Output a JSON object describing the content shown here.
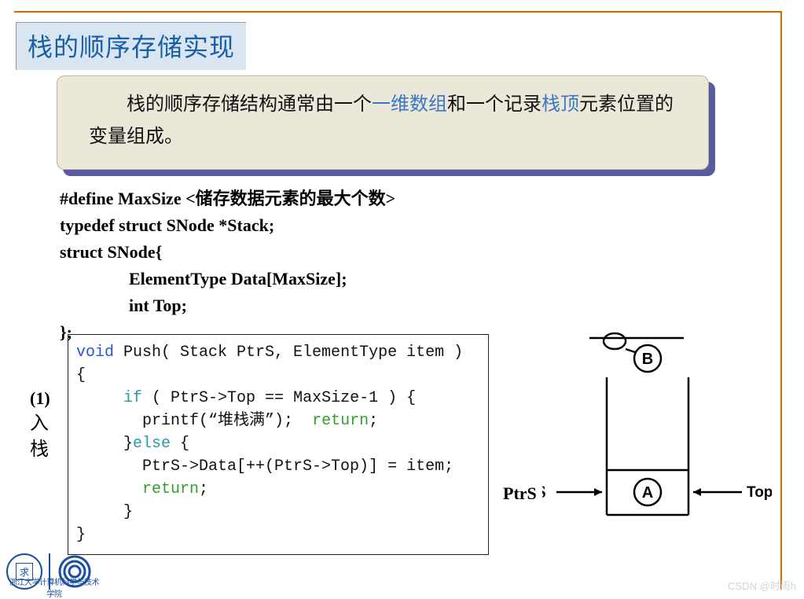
{
  "title": "栈的顺序存储实现",
  "intro": {
    "pre": "栈的顺序存储结构通常由一个",
    "hl1": "一维数组",
    "mid1": "和一个记录",
    "hl2": "栈顶",
    "post": "元素位置的变量组成。"
  },
  "codeDef": {
    "l1a": "#define MaxSize  <",
    "l1b": "储存数据元素的最大个数",
    "l1c": ">",
    "l2": "typedef  struct SNode *Stack;",
    "l3": "struct SNode{",
    "l4": "ElementType Data[MaxSize];",
    "l5": "int Top;",
    "l6": "};"
  },
  "pushLabel": {
    "num": "(1)",
    "zh1": "入",
    "zh2": "栈"
  },
  "pushCode": {
    "l1a": "void",
    "l1b": " Push( Stack PtrS, ElementType item )",
    "l2": "{",
    "l3a": "     ",
    "l3b": "if",
    "l3c": " ( PtrS->Top == MaxSize-1 ) {",
    "l4a": "       printf(",
    "l4b": "“堆栈满”",
    "l4c": ");  ",
    "l4d": "return",
    "l4e": ";",
    "l5a": "     }",
    "l5b": "else",
    "l5c": " {",
    "l6": "       PtrS->Data[++(PtrS->Top)] = item;",
    "l7a": "       ",
    "l7b": "return",
    "l7c": ";",
    "l8": "     }",
    "l9": "}"
  },
  "diagram": {
    "nodeTop": "B",
    "nodeBottom": "A",
    "leftLabel": "PtrS",
    "rightLabel": "Top"
  },
  "footer": {
    "org": "浙江大学计算机科学与技术学院"
  },
  "watermark": "CSDN @时雨h"
}
